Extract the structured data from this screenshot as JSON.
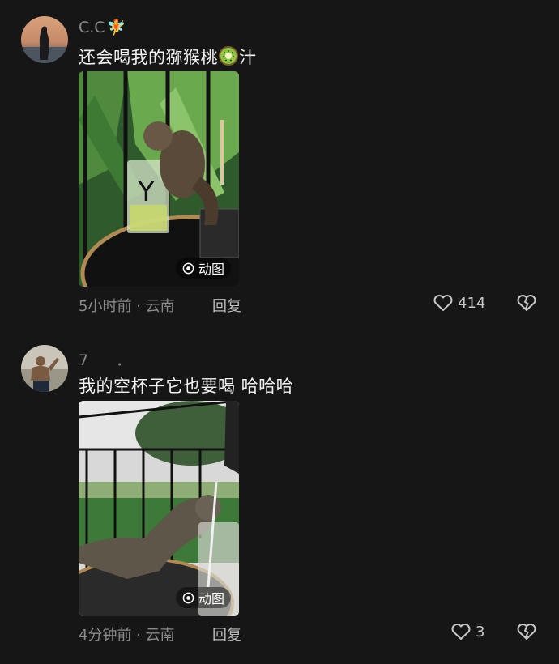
{
  "comments": [
    {
      "username": "C.C",
      "username_emoji": "🧚",
      "text": "还会喝我的猕猴桃",
      "text_suffix": "汁",
      "media_badge": "动图",
      "time": "5小时前",
      "location": "云南",
      "separator": "·",
      "reply_label": "回复",
      "like_count": "414"
    },
    {
      "username": "7",
      "username_extra": "．",
      "text": "我的空杯子它也要喝 哈哈哈",
      "media_badge": "动图",
      "time": "4分钟前",
      "location": "云南",
      "separator": "·",
      "reply_label": "回复",
      "like_count": "3"
    }
  ],
  "icons": {
    "like": "heart-outline-icon",
    "dislike": "broken-heart-icon",
    "gif": "gif-play-icon"
  },
  "colors": {
    "background": "#161616",
    "text": "#f1f1f1",
    "meta": "#8a8a8a"
  }
}
